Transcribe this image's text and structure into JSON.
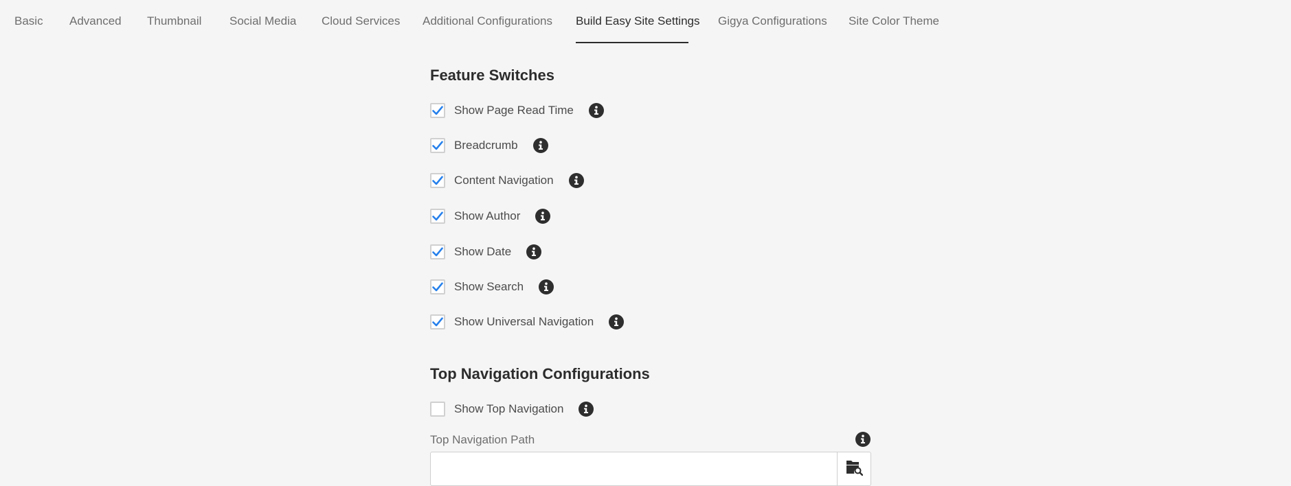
{
  "tabs": [
    {
      "label": "Basic",
      "active": false
    },
    {
      "label": "Advanced",
      "active": false
    },
    {
      "label": "Thumbnail",
      "active": false
    },
    {
      "label": "Social Media",
      "active": false
    },
    {
      "label": "Cloud Services",
      "active": false
    },
    {
      "label": "Additional Configurations",
      "active": false
    },
    {
      "label": "Build Easy Site Settings",
      "active": true
    },
    {
      "label": "Gigya Configurations",
      "active": false
    },
    {
      "label": "Site Color Theme",
      "active": false
    }
  ],
  "feature_switches": {
    "heading": "Feature Switches",
    "items": [
      {
        "label": "Show Page Read Time",
        "checked": true
      },
      {
        "label": "Breadcrumb",
        "checked": true
      },
      {
        "label": "Content Navigation",
        "checked": true
      },
      {
        "label": "Show Author",
        "checked": true
      },
      {
        "label": "Show Date",
        "checked": true
      },
      {
        "label": "Show Search",
        "checked": true
      },
      {
        "label": "Show Universal Navigation",
        "checked": true
      }
    ]
  },
  "top_navigation": {
    "heading": "Top Navigation Configurations",
    "show_top_navigation": {
      "label": "Show Top Navigation",
      "checked": false
    },
    "path_field": {
      "label": "Top Navigation Path",
      "value": ""
    }
  },
  "icons": {
    "info": "info-icon",
    "checkmark": "checkmark-icon",
    "picker": "folder-search-icon"
  },
  "colors": {
    "background": "#f5f5f5",
    "checkmark": "#2680eb",
    "active_tab_underline": "#2c2c2c",
    "info_icon": "#2e2e2e"
  }
}
